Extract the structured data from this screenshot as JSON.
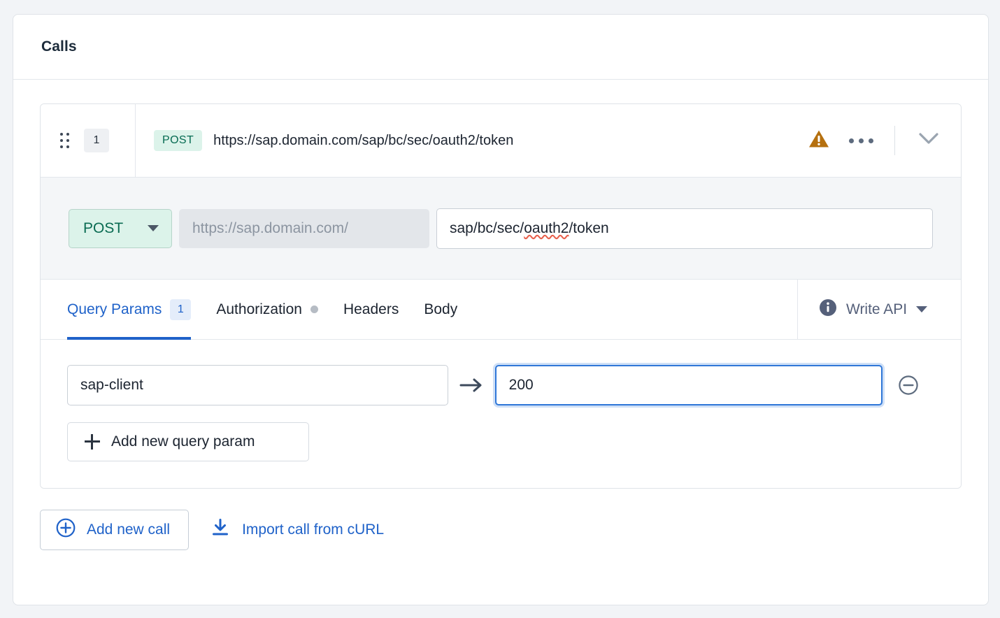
{
  "card": {
    "title": "Calls"
  },
  "call": {
    "order": "1",
    "method_chip": "POST",
    "full_url": "https://sap.domain.com/sap/bc/sec/oauth2/token",
    "has_warning": true,
    "warning_color": "#b5700f",
    "method_select_value": "POST",
    "base_url": "https://sap.domain.com/",
    "path_value_prefix": "sap/bc/sec/",
    "path_value_spellchecked": "oauth2",
    "path_value_suffix": "/token",
    "path_full": "sap/bc/sec/oauth2/token",
    "tabs": [
      {
        "label": "Query Params",
        "count": "1",
        "active": true,
        "dot": false
      },
      {
        "label": "Authorization",
        "count": "",
        "active": false,
        "dot": true
      },
      {
        "label": "Headers",
        "count": "",
        "active": false,
        "dot": false
      },
      {
        "label": "Body",
        "count": "",
        "active": false,
        "dot": false
      }
    ],
    "api_mode": {
      "label": "Write API",
      "icon": "info-icon"
    },
    "query_params": [
      {
        "key": "sap-client",
        "value": "200",
        "value_focused": true
      }
    ],
    "add_param_label": "Add new query param"
  },
  "footer": {
    "add_call_label": "Add new call",
    "import_curl_label": "Import call from cURL"
  },
  "colors": {
    "accent_blue": "#1f62c9",
    "method_green": "#066b52",
    "method_green_bg": "#dcf3ea",
    "warning_amber": "#b5700f",
    "page_bg": "#f2f4f7"
  }
}
